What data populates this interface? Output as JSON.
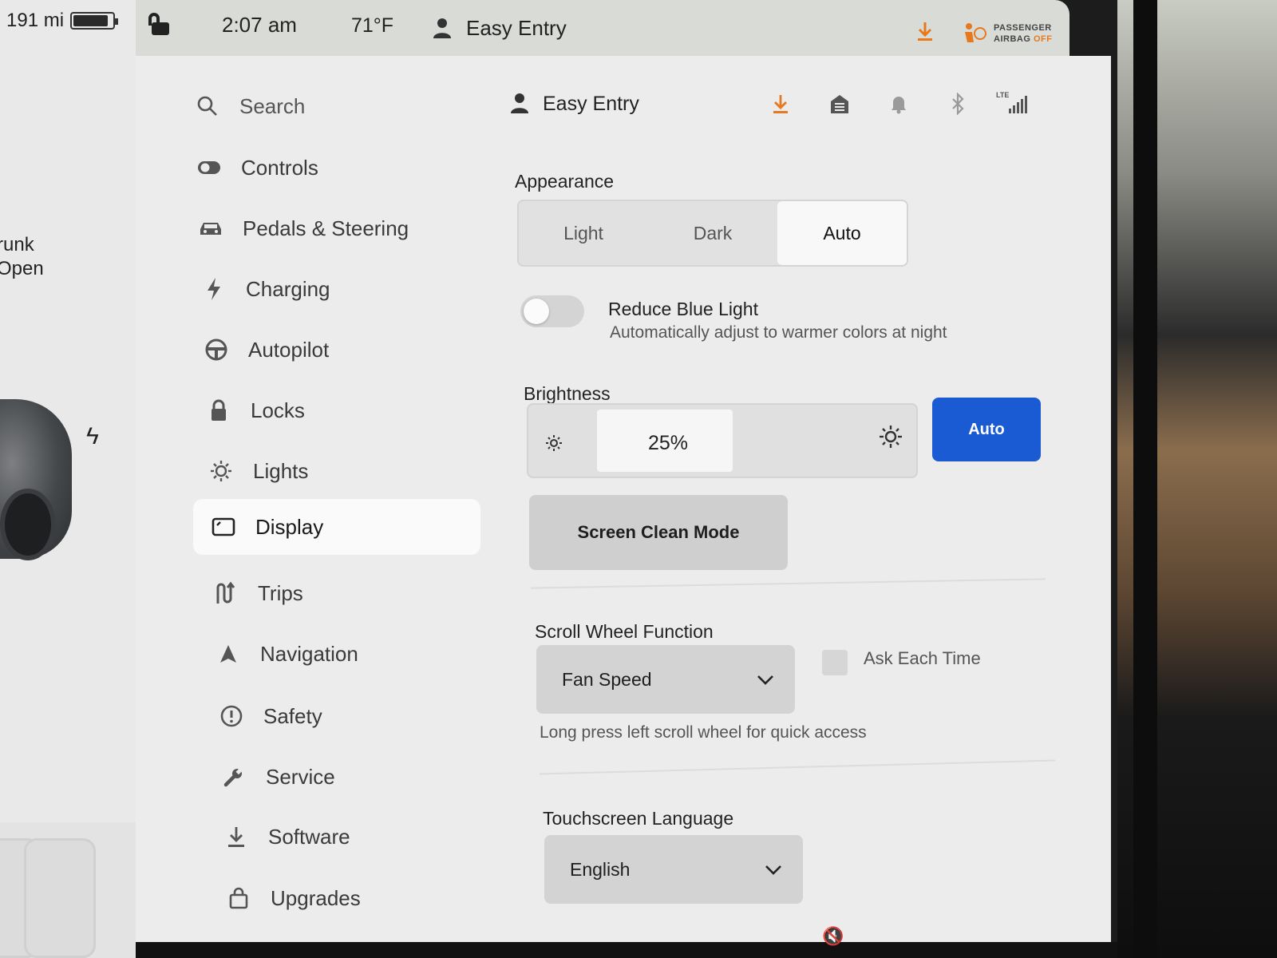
{
  "status": {
    "range": "191 mi",
    "battery_level": 0.9,
    "time": "2:07 am",
    "temperature": "71°F",
    "profile": "Easy Entry",
    "airbag_line1": "PASSENGER",
    "airbag_line2": "AIRBAG",
    "airbag_state": "OFF",
    "accent_color": "#e8781e"
  },
  "car_panel": {
    "trunk_line1": "runk",
    "trunk_line2": "Open"
  },
  "sidebar": {
    "search": "Search",
    "items": [
      {
        "label": "Controls",
        "icon": "toggle-icon"
      },
      {
        "label": "Pedals & Steering",
        "icon": "car-icon"
      },
      {
        "label": "Charging",
        "icon": "bolt-icon"
      },
      {
        "label": "Autopilot",
        "icon": "steering-wheel-icon"
      },
      {
        "label": "Locks",
        "icon": "lock-icon"
      },
      {
        "label": "Lights",
        "icon": "sun-icon"
      },
      {
        "label": "Display",
        "icon": "display-icon",
        "active": true
      },
      {
        "label": "Trips",
        "icon": "trips-icon"
      },
      {
        "label": "Navigation",
        "icon": "navigation-arrow-icon"
      },
      {
        "label": "Safety",
        "icon": "alert-circle-icon"
      },
      {
        "label": "Service",
        "icon": "wrench-icon"
      },
      {
        "label": "Software",
        "icon": "download-icon"
      },
      {
        "label": "Upgrades",
        "icon": "shopping-bag-icon"
      }
    ]
  },
  "header": {
    "profile": "Easy Entry",
    "icons": [
      "download-icon",
      "garage-icon",
      "bell-icon",
      "bluetooth-icon",
      "lte-signal-icon"
    ],
    "lte_label": "LTE"
  },
  "display": {
    "appearance": {
      "label": "Appearance",
      "options": [
        "Light",
        "Dark",
        "Auto"
      ],
      "selected": "Auto"
    },
    "reduce_blue_light": {
      "title": "Reduce Blue Light",
      "subtitle": "Automatically adjust to warmer colors at night",
      "enabled": false
    },
    "brightness": {
      "label": "Brightness",
      "value_text": "25%",
      "value": 0.25,
      "auto_label": "Auto",
      "auto_color": "#1a5bd3"
    },
    "screen_clean": "Screen Clean Mode",
    "scroll_wheel": {
      "label": "Scroll Wheel Function",
      "selected": "Fan Speed",
      "ask_each_time": "Ask Each Time",
      "ask_checked": false,
      "hint": "Long press left scroll wheel for quick access"
    },
    "language": {
      "label": "Touchscreen Language",
      "selected": "English"
    }
  }
}
